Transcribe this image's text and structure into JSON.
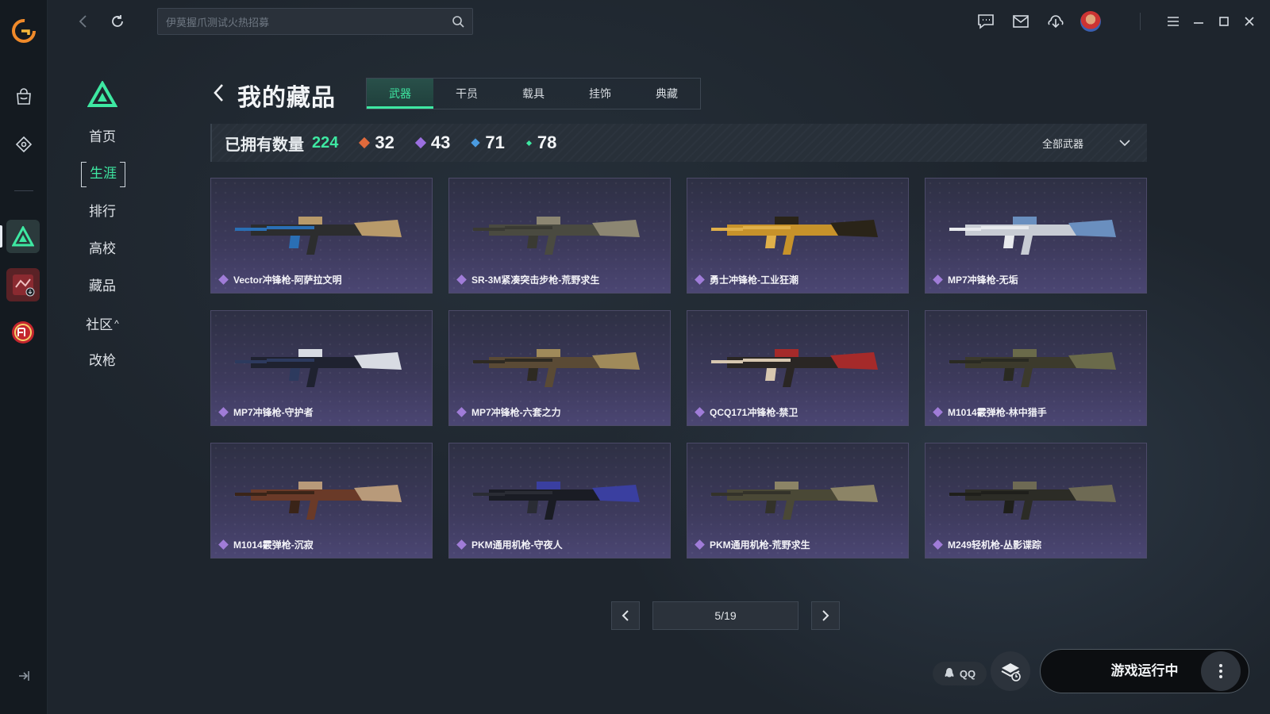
{
  "app": {
    "search_placeholder": "伊莫握爪测试火热招募"
  },
  "sidenav": {
    "items": [
      {
        "label": "首页"
      },
      {
        "label": "生涯"
      },
      {
        "label": "排行"
      },
      {
        "label": "高校"
      },
      {
        "label": "藏品"
      },
      {
        "label": "社区"
      },
      {
        "label": "改枪"
      }
    ],
    "community_caret": "^"
  },
  "page": {
    "title": "我的藏品",
    "tabs": [
      "武器",
      "干员",
      "载具",
      "挂饰",
      "典藏"
    ],
    "active_tab": "武器"
  },
  "stats": {
    "owned_label": "已拥有数量",
    "owned_total": "224",
    "rarities": [
      {
        "value": "32",
        "color": "#e06a3c"
      },
      {
        "value": "43",
        "color": "#9b6fe0"
      },
      {
        "value": "71",
        "color": "#4a9be0"
      },
      {
        "value": "78",
        "color": "#3ee8a2"
      }
    ],
    "filter_label": "全部武器"
  },
  "weapons": [
    {
      "name": "Vector冲锋枪-阿萨拉文明",
      "palette": [
        "#2c2d2e",
        "#b89a6a",
        "#2a6fb5"
      ]
    },
    {
      "name": "SR-3M紧凑突击步枪-荒野求生",
      "palette": [
        "#4a4a40",
        "#8c8672",
        "#3a3a33"
      ]
    },
    {
      "name": "勇士冲锋枪-工业狂潮",
      "palette": [
        "#c7922a",
        "#2a2418",
        "#e0b04a"
      ]
    },
    {
      "name": "MP7冲锋枪-无垢",
      "palette": [
        "#c8ccd4",
        "#6a8fbf",
        "#e8eaee"
      ]
    },
    {
      "name": "MP7冲锋枪-守护者",
      "palette": [
        "#1f2230",
        "#d8dbe3",
        "#2d3a5e"
      ]
    },
    {
      "name": "MP7冲锋枪-六套之力",
      "palette": [
        "#5a4a35",
        "#a08a5a",
        "#2e2a22"
      ]
    },
    {
      "name": "QCQ171冲锋枪-禁卫",
      "palette": [
        "#2a2624",
        "#a52a2a",
        "#d7c7b0"
      ]
    },
    {
      "name": "M1014霰弹枪-林中猎手",
      "palette": [
        "#3c3a2c",
        "#6a6a4a",
        "#2a2a22"
      ]
    },
    {
      "name": "M1014霰弹枪-沉寂",
      "palette": [
        "#6a3a28",
        "#b89a7a",
        "#3a2418"
      ]
    },
    {
      "name": "PKM通用机枪-守夜人",
      "palette": [
        "#1a1c24",
        "#3a3fa0",
        "#2a2c34"
      ]
    },
    {
      "name": "PKM通用机枪-荒野求生",
      "palette": [
        "#4a4836",
        "#8c8466",
        "#33322a"
      ]
    },
    {
      "name": "M249轻机枪-丛影谍踪",
      "palette": [
        "#2c2c26",
        "#6e6a54",
        "#1f1f1b"
      ]
    }
  ],
  "pager": {
    "label": "5/19"
  },
  "bottom": {
    "qq_label": "QQ",
    "run_button": "游戏运行中"
  }
}
